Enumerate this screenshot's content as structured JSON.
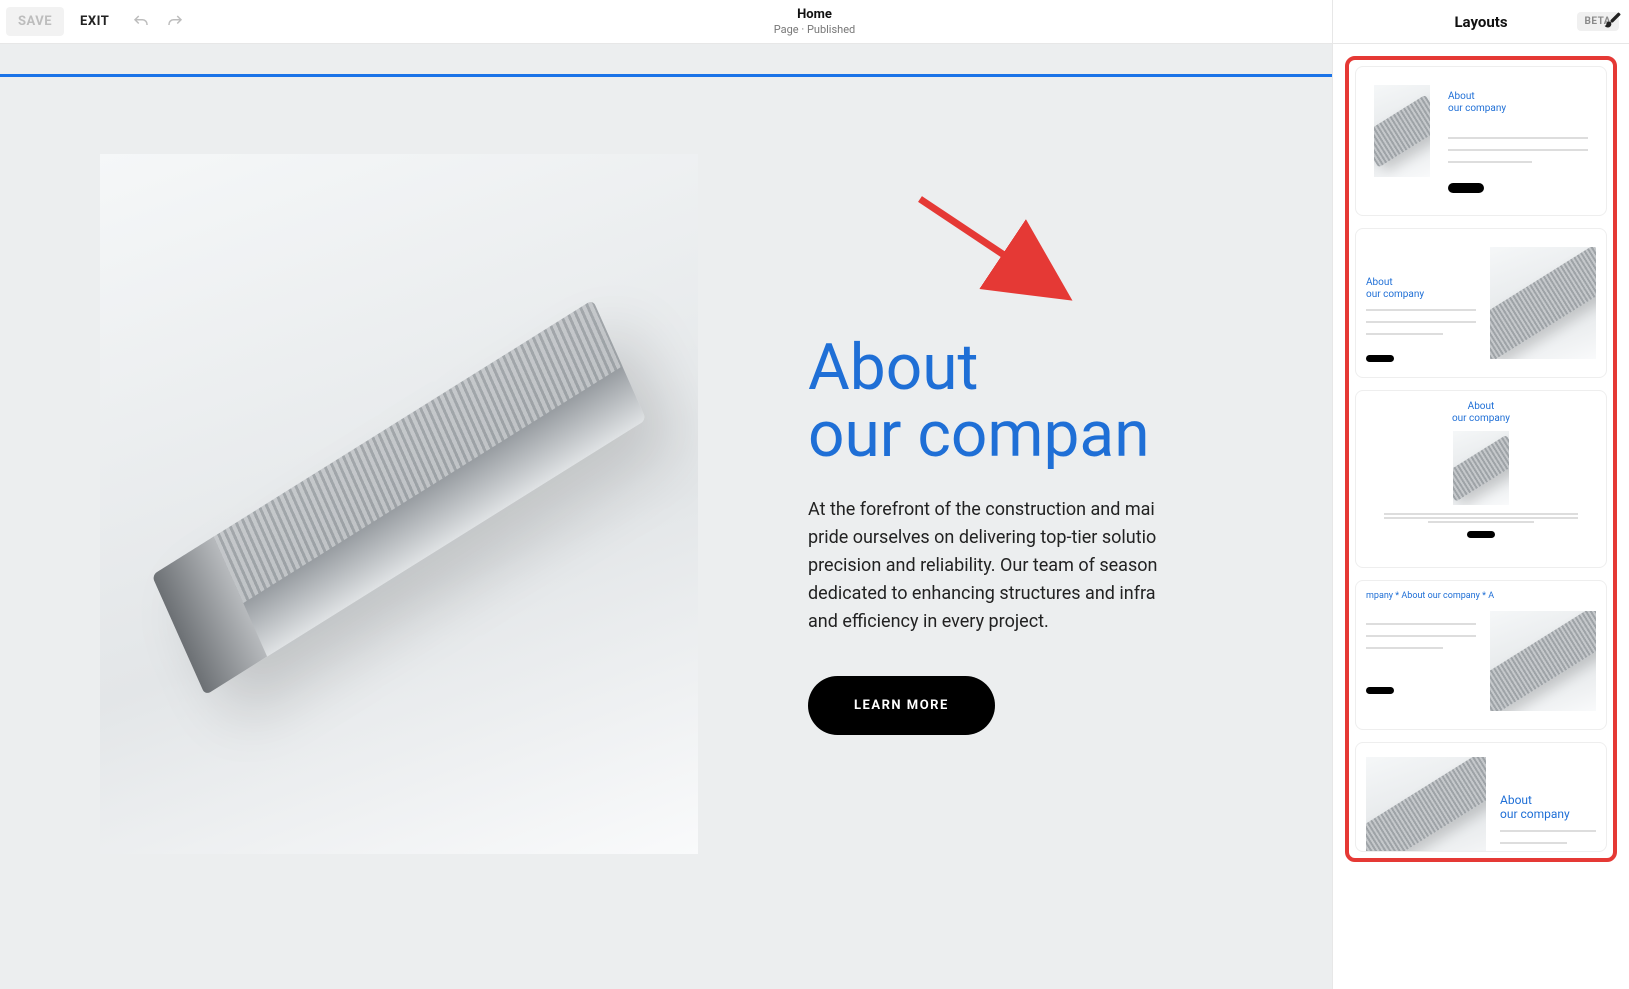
{
  "topbar": {
    "save_label": "SAVE",
    "exit_label": "EXIT",
    "title": "Home",
    "subtitle": "Page · Published"
  },
  "section": {
    "heading": "About\nour compan",
    "body_line1": "At the forefront of the construction and mai",
    "body_line2": "pride ourselves on delivering top-tier solutio",
    "body_line3": "precision and reliability. Our team of season",
    "body_line4": "dedicated to enhancing structures and infra",
    "body_line5": "and efficiency in every project.",
    "cta_label": "LEARN MORE"
  },
  "panel": {
    "title": "Layouts",
    "badge": "BETA",
    "cards": [
      {
        "title": "About\nour company"
      },
      {
        "title": "About\nour company"
      },
      {
        "title": "About\nour company"
      },
      {
        "title": "About\nour company",
        "marquee": "mpany  *  About our company  *  A"
      },
      {
        "title": "About\nour company"
      }
    ]
  },
  "colors": {
    "accent": "#1f6fd6",
    "highlight_bar": "#1a73e8",
    "annotation": "#e53935"
  }
}
